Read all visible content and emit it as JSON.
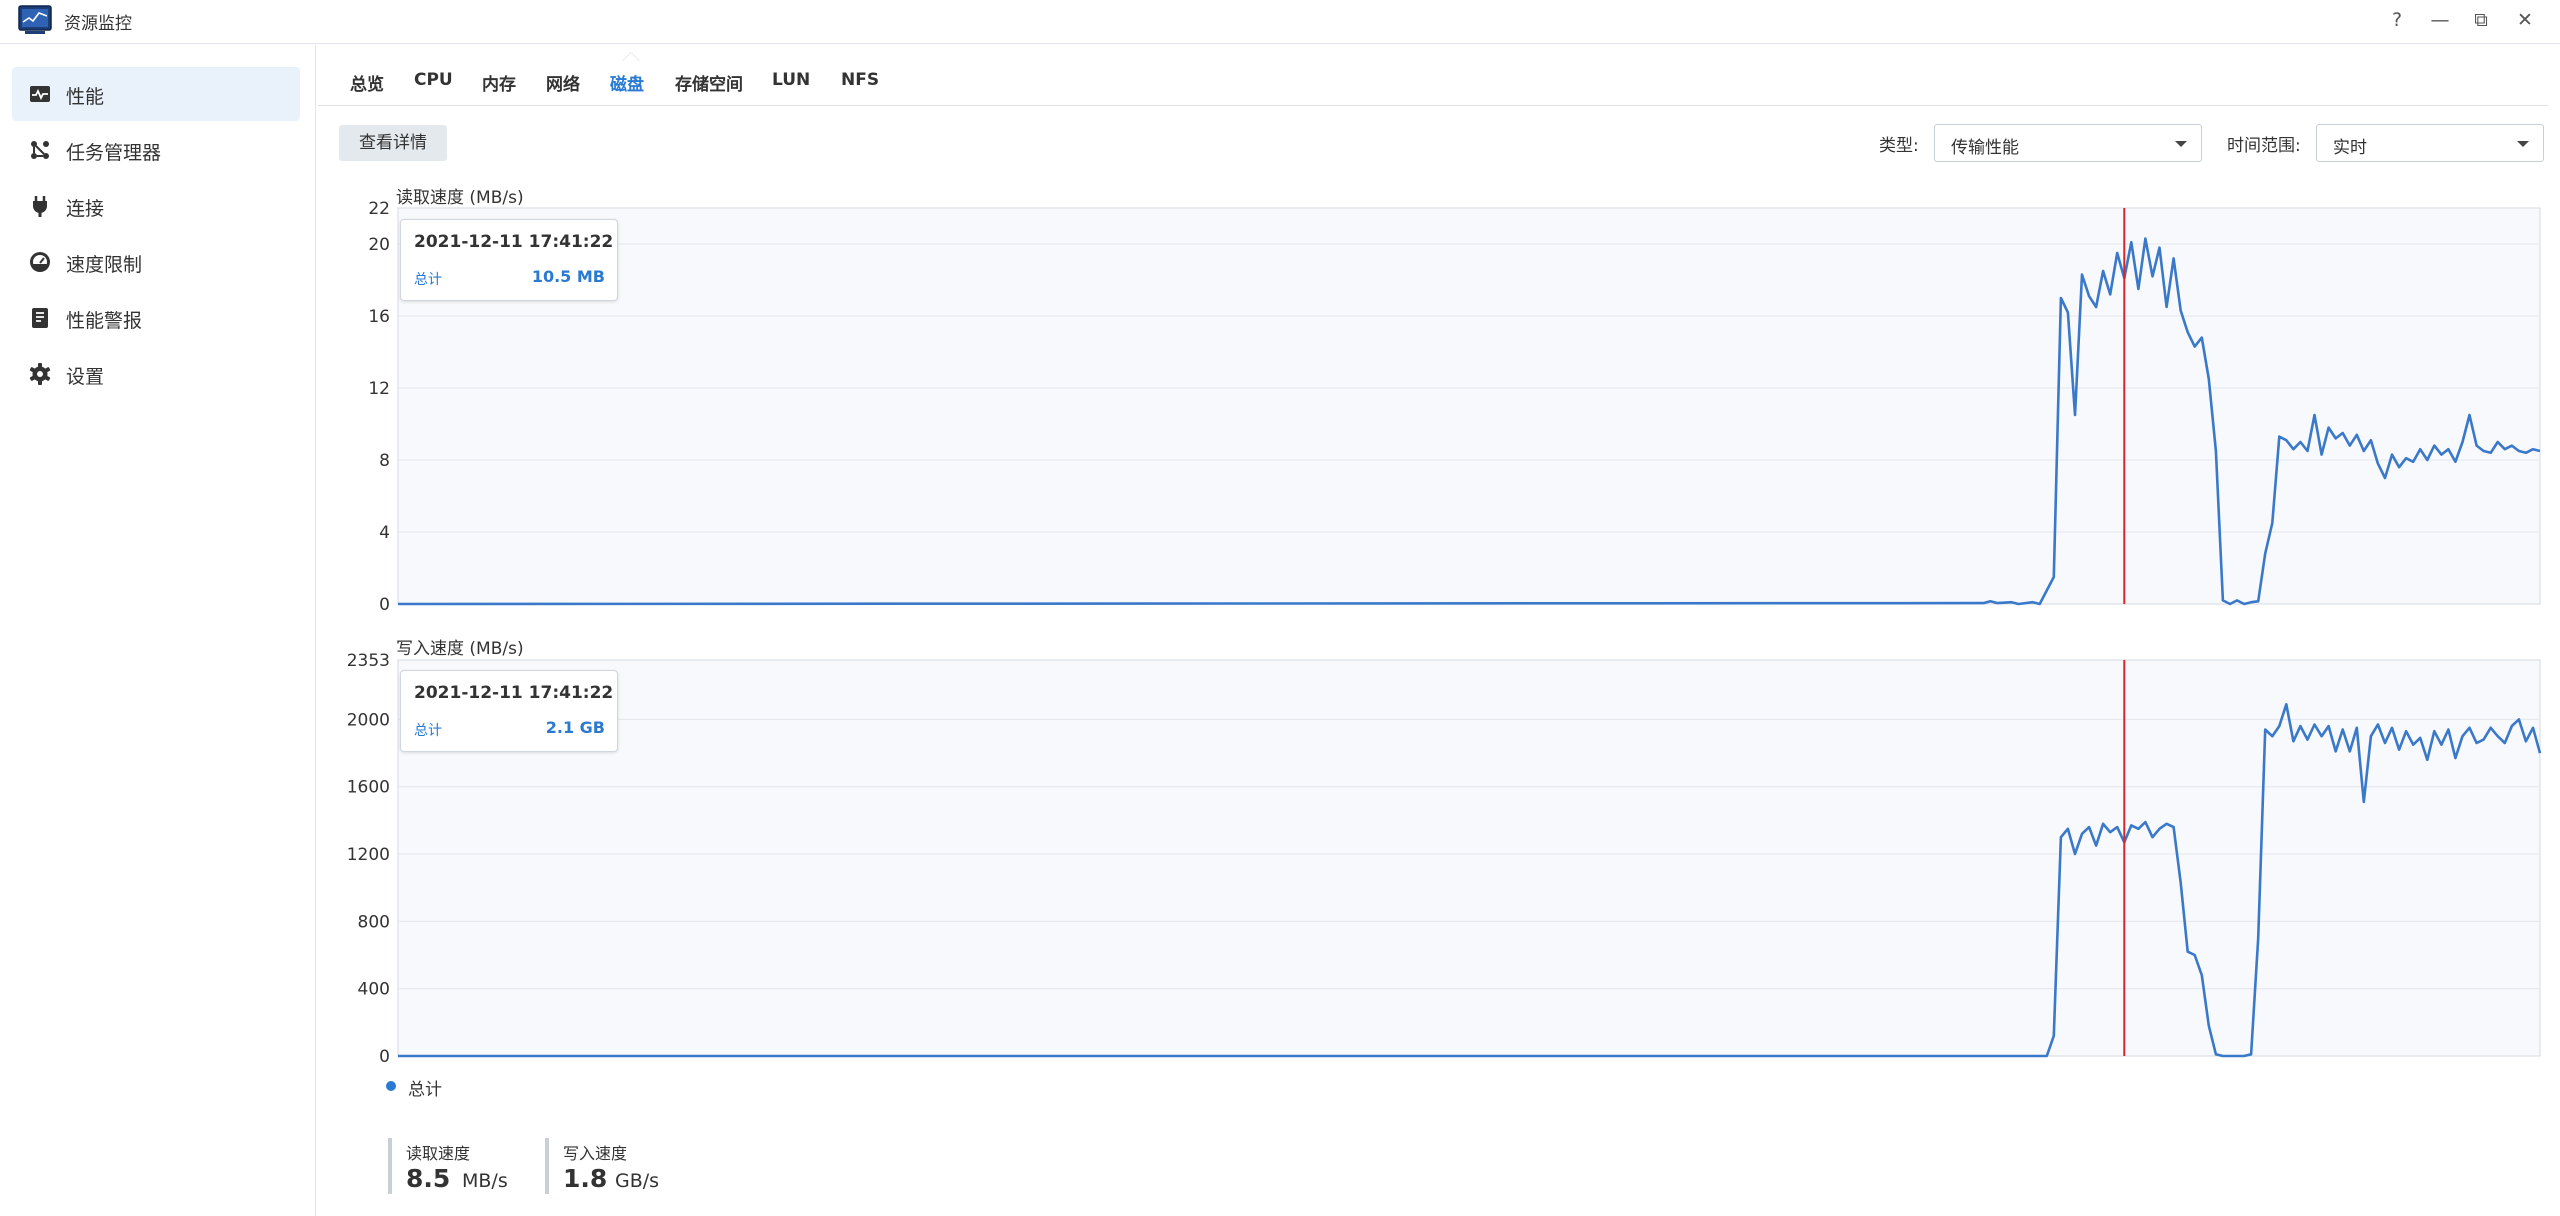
{
  "window": {
    "title": "资源监控",
    "controls": [
      "?",
      "—",
      "⧉",
      "✕"
    ]
  },
  "sidebar": {
    "items": [
      {
        "label": "性能",
        "icon": "performance-icon",
        "active": true
      },
      {
        "label": "任务管理器",
        "icon": "task-manager-icon",
        "active": false
      },
      {
        "label": "连接",
        "icon": "plug-icon",
        "active": false
      },
      {
        "label": "速度限制",
        "icon": "gauge-icon",
        "active": false
      },
      {
        "label": "性能警报",
        "icon": "alert-icon",
        "active": false
      },
      {
        "label": "设置",
        "icon": "gear-icon",
        "active": false
      }
    ]
  },
  "tabs": [
    {
      "label": "总览",
      "active": false
    },
    {
      "label": "CPU",
      "active": false
    },
    {
      "label": "内存",
      "active": false
    },
    {
      "label": "网络",
      "active": false
    },
    {
      "label": "磁盘",
      "active": true
    },
    {
      "label": "存储空间",
      "active": false
    },
    {
      "label": "LUN",
      "active": false
    },
    {
      "label": "NFS",
      "active": false
    }
  ],
  "toolbar": {
    "detail_button": "查看详情",
    "type_label": "类型:",
    "type_value": "传输性能",
    "range_label": "时间范围:",
    "range_value": "实时"
  },
  "colors": {
    "accent": "#2a7ad3",
    "series_line": "#3a78c9",
    "cursor_line": "#d9262b",
    "plot_bg": "#f7f9fc",
    "grid": "#e3e8ee"
  },
  "chart_data": [
    {
      "type": "line",
      "title": "读取速度 (MB/s)",
      "ylim": [
        0,
        22
      ],
      "yticks": [
        0,
        4,
        8,
        12,
        16,
        20,
        22
      ],
      "grid": true,
      "cursor_index": 245,
      "tooltip": {
        "time": "2021-12-11 17:41:22",
        "series": "总计",
        "value": "10.5 MB"
      },
      "series": [
        {
          "name": "总计",
          "segments": [
            [
              0,
              0
            ],
            [
              225,
              0.05
            ],
            [
              226,
              0.15
            ],
            [
              227,
              0.05
            ],
            [
              229,
              0.1
            ],
            [
              230,
              0
            ],
            [
              232,
              0.1
            ],
            [
              233,
              0
            ],
            [
              235,
              1.5
            ],
            [
              236,
              17
            ],
            [
              237,
              16.2
            ],
            [
              238,
              10.5
            ],
            [
              239,
              18.3
            ],
            [
              240,
              17.1
            ],
            [
              241,
              16.5
            ],
            [
              242,
              18.5
            ],
            [
              243,
              17.2
            ],
            [
              244,
              19.5
            ],
            [
              245,
              18.1
            ],
            [
              246,
              20.1
            ],
            [
              247,
              17.5
            ],
            [
              248,
              20.3
            ],
            [
              249,
              18.2
            ],
            [
              250,
              19.8
            ],
            [
              251,
              16.5
            ],
            [
              252,
              19.2
            ],
            [
              253,
              16.3
            ],
            [
              254,
              15.1
            ],
            [
              255,
              14.3
            ],
            [
              256,
              14.8
            ],
            [
              257,
              12.5
            ],
            [
              258,
              8.5
            ],
            [
              259,
              0.2
            ],
            [
              260,
              0
            ],
            [
              261,
              0.2
            ],
            [
              262,
              0
            ],
            [
              263,
              0.1
            ],
            [
              264,
              0.15
            ],
            [
              265,
              2.8
            ],
            [
              266,
              4.5
            ],
            [
              267,
              9.3
            ],
            [
              268,
              9.1
            ],
            [
              269,
              8.6
            ],
            [
              270,
              9.0
            ],
            [
              271,
              8.5
            ],
            [
              272,
              10.5
            ],
            [
              273,
              8.3
            ],
            [
              274,
              9.8
            ],
            [
              275,
              9.2
            ],
            [
              276,
              9.5
            ],
            [
              277,
              8.8
            ],
            [
              278,
              9.4
            ],
            [
              279,
              8.5
            ],
            [
              280,
              9.1
            ],
            [
              281,
              7.8
            ],
            [
              282,
              7.0
            ],
            [
              283,
              8.3
            ],
            [
              284,
              7.6
            ],
            [
              285,
              8.1
            ],
            [
              286,
              7.9
            ],
            [
              287,
              8.6
            ],
            [
              288,
              8.0
            ],
            [
              289,
              8.8
            ],
            [
              290,
              8.3
            ],
            [
              291,
              8.6
            ],
            [
              292,
              7.9
            ],
            [
              293,
              9.0
            ],
            [
              294,
              10.5
            ],
            [
              295,
              8.8
            ],
            [
              296,
              8.5
            ],
            [
              297,
              8.4
            ],
            [
              298,
              9.0
            ],
            [
              299,
              8.6
            ],
            [
              300,
              8.8
            ],
            [
              301,
              8.5
            ],
            [
              302,
              8.4
            ],
            [
              303,
              8.6
            ],
            [
              304,
              8.5
            ]
          ]
        }
      ]
    },
    {
      "type": "line",
      "title": "写入速度 (MB/s)",
      "ylim": [
        0,
        2353
      ],
      "yticks": [
        0,
        400,
        800,
        1200,
        1600,
        2000,
        2353
      ],
      "grid": true,
      "cursor_index": 245,
      "tooltip": {
        "time": "2021-12-11 17:41:22",
        "series": "总计",
        "value": "2.1 GB"
      },
      "series": [
        {
          "name": "总计",
          "segments": [
            [
              0,
              0
            ],
            [
              234,
              0
            ],
            [
              235,
              120
            ],
            [
              236,
              1300
            ],
            [
              237,
              1350
            ],
            [
              238,
              1200
            ],
            [
              239,
              1320
            ],
            [
              240,
              1360
            ],
            [
              241,
              1250
            ],
            [
              242,
              1380
            ],
            [
              243,
              1330
            ],
            [
              244,
              1360
            ],
            [
              245,
              1270
            ],
            [
              246,
              1370
            ],
            [
              247,
              1350
            ],
            [
              248,
              1390
            ],
            [
              249,
              1300
            ],
            [
              250,
              1350
            ],
            [
              251,
              1380
            ],
            [
              252,
              1360
            ],
            [
              253,
              1030
            ],
            [
              254,
              620
            ],
            [
              255,
              600
            ],
            [
              256,
              480
            ],
            [
              257,
              180
            ],
            [
              258,
              10
            ],
            [
              259,
              0
            ],
            [
              262,
              0
            ],
            [
              263,
              10
            ],
            [
              264,
              700
            ],
            [
              265,
              1940
            ],
            [
              266,
              1900
            ],
            [
              267,
              1960
            ],
            [
              268,
              2090
            ],
            [
              269,
              1870
            ],
            [
              270,
              1960
            ],
            [
              271,
              1880
            ],
            [
              272,
              1970
            ],
            [
              273,
              1900
            ],
            [
              274,
              1960
            ],
            [
              275,
              1810
            ],
            [
              276,
              1940
            ],
            [
              277,
              1810
            ],
            [
              278,
              1950
            ],
            [
              279,
              1510
            ],
            [
              280,
              1900
            ],
            [
              281,
              1970
            ],
            [
              282,
              1860
            ],
            [
              283,
              1950
            ],
            [
              284,
              1820
            ],
            [
              285,
              1930
            ],
            [
              286,
              1850
            ],
            [
              287,
              1890
            ],
            [
              288,
              1760
            ],
            [
              289,
              1930
            ],
            [
              290,
              1850
            ],
            [
              291,
              1940
            ],
            [
              292,
              1770
            ],
            [
              293,
              1900
            ],
            [
              294,
              1950
            ],
            [
              295,
              1860
            ],
            [
              296,
              1880
            ],
            [
              297,
              1950
            ],
            [
              298,
              1900
            ],
            [
              299,
              1860
            ],
            [
              300,
              1960
            ],
            [
              301,
              2000
            ],
            [
              302,
              1870
            ],
            [
              303,
              1950
            ],
            [
              304,
              1800
            ]
          ]
        }
      ]
    }
  ],
  "legend": {
    "label": "总计"
  },
  "stats": [
    {
      "label": "读取速度",
      "value": "8.5",
      "unit": "MB/s"
    },
    {
      "label": "写入速度",
      "value": "1.8",
      "unit": "GB/s"
    }
  ]
}
